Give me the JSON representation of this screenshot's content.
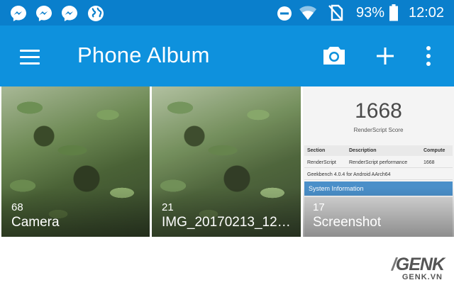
{
  "status_bar": {
    "battery_percent": "93%",
    "time": "12:02",
    "notification_icons": [
      "messenger-icon",
      "messenger-icon",
      "messenger-icon",
      "globe-icon"
    ],
    "system_icons": [
      "do-not-disturb-icon",
      "wifi-icon",
      "no-sim-icon",
      "battery-icon"
    ]
  },
  "app_bar": {
    "title": "Phone Album",
    "actions": [
      "camera-icon",
      "add-icon",
      "more-vert-icon"
    ]
  },
  "albums": [
    {
      "count": "68",
      "name": "Camera"
    },
    {
      "count": "21",
      "name": "IMG_20170213_1202…"
    },
    {
      "count": "17",
      "name": "Screenshot"
    }
  ],
  "screenshot_thumb": {
    "score": "1668",
    "score_label": "RenderScript Score",
    "table_headers": [
      "Section",
      "Description",
      "Compute"
    ],
    "table_row": [
      "RenderScript",
      "RenderScript performance",
      "1668"
    ],
    "version": "Geekbench 4.0.4 for Android AArch64",
    "section_title": "System Information"
  },
  "watermark": {
    "logo": "GENK",
    "site": "GENK.VN"
  },
  "colors": {
    "status_bar": "#0a7fcc",
    "app_bar": "#0e91dd"
  }
}
